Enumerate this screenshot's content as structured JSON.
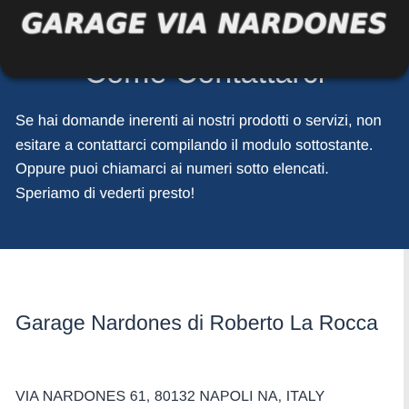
{
  "header": {
    "title": "GARAGE VIA NARDONES"
  },
  "contact": {
    "heading": "Come Contattarci",
    "intro_lines": [
      "Se hai domande inerenti ai nostri prodotti o servizi, non esitare a contattarci compilando il modulo sottostante.",
      "Oppure puoi chiamarci ai numeri sotto elencati.",
      "Speriamo di vederti presto!"
    ]
  },
  "business": {
    "name": "Garage Nardones di Roberto La Rocca",
    "address": "VIA NARDONES 61, 80132 NAPOLI NA, ITALY"
  },
  "colors": {
    "header_bg": "#1d1d1d",
    "section_bg": "#173c6b",
    "text_dark": "#24344a"
  }
}
